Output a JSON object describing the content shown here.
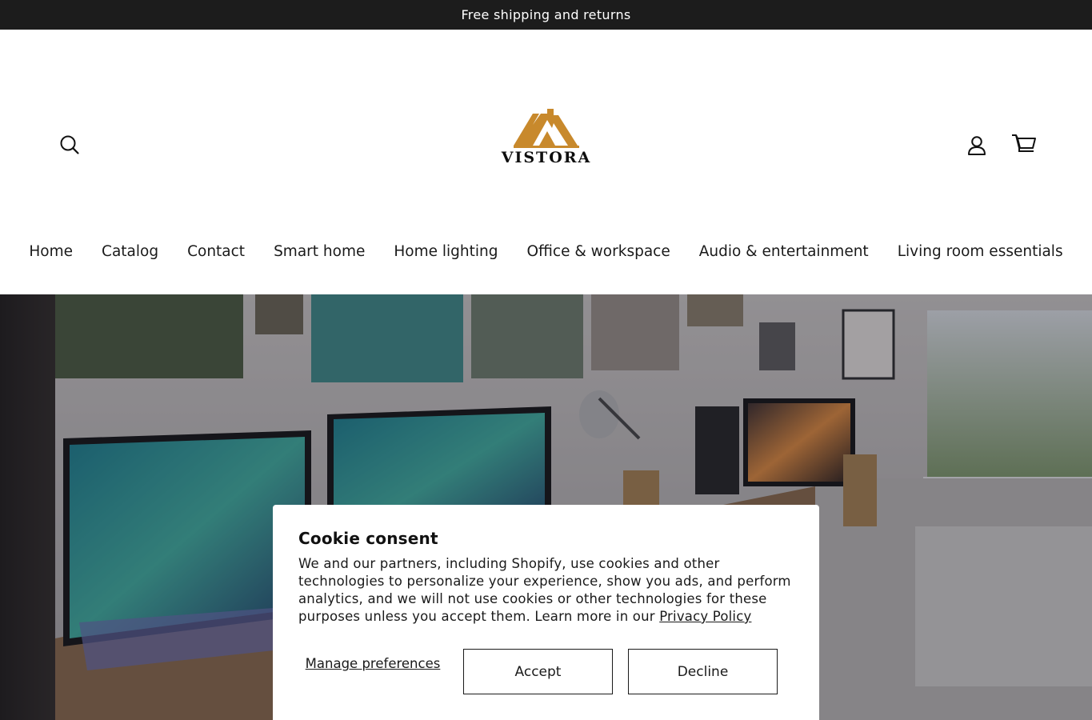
{
  "announcement": {
    "text": "Free shipping and returns"
  },
  "header": {
    "logo_text": "VISTORA",
    "icons": {
      "search": "search-icon",
      "account": "account-icon",
      "cart": "cart-icon"
    }
  },
  "nav": {
    "items": [
      {
        "label": "Home"
      },
      {
        "label": "Catalog"
      },
      {
        "label": "Contact"
      },
      {
        "label": "Smart home"
      },
      {
        "label": "Home lighting"
      },
      {
        "label": "Office & workspace"
      },
      {
        "label": "Audio & entertainment"
      },
      {
        "label": "Living room essentials"
      }
    ]
  },
  "cookie": {
    "title": "Cookie consent",
    "body": "We and our partners, including Shopify, use cookies and other technologies to personalize your experience, show you ads, and perform analytics, and we will not use cookies or other technologies for these purposes unless you accept them. Learn more in our ",
    "privacy_link": "Privacy Policy",
    "manage_label": "Manage preferences",
    "accept_label": "Accept",
    "decline_label": "Decline"
  },
  "colors": {
    "announcement_bg": "#1c1c1c",
    "logo_gold": "#c8892c",
    "text": "#1a1a1a"
  }
}
